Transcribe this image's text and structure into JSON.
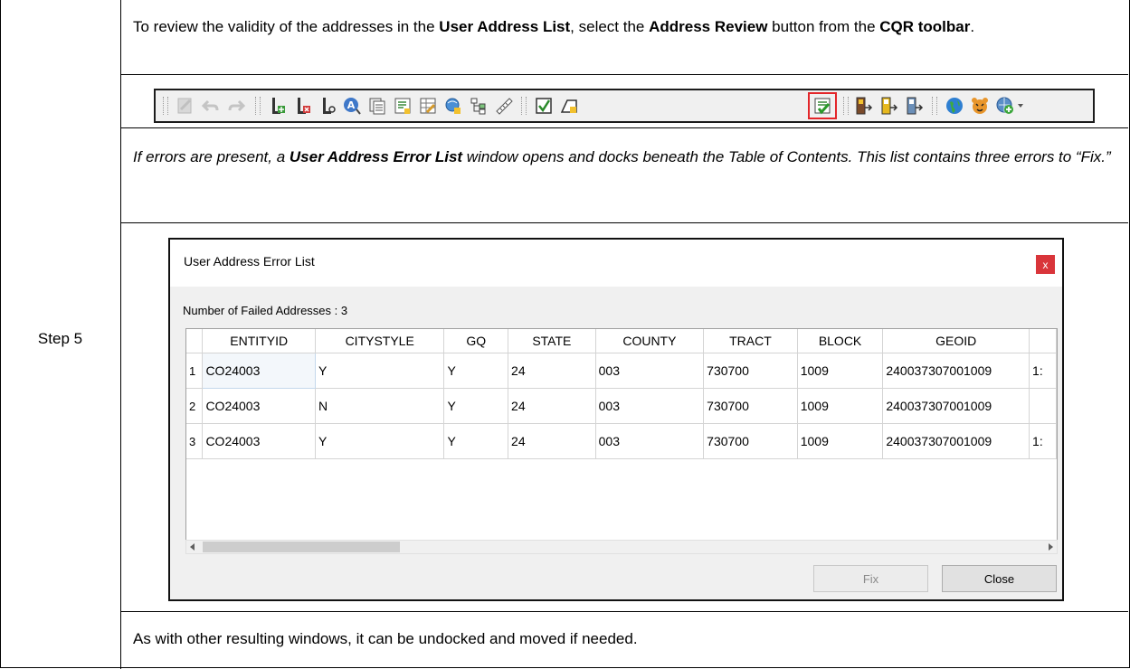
{
  "step_label": "Step 5",
  "intro": {
    "p1": "To review the validity of the addresses in the ",
    "b1": "User Address List",
    "p2": ", select the ",
    "b2": "Address Review",
    "p3": " button from the ",
    "b3": "CQR toolbar",
    "p4": "."
  },
  "toolbar": {
    "icons": [
      "edit-disabled-icon",
      "undo-icon",
      "redo-icon",
      "add-address-icon",
      "delete-address-icon",
      "move-address-icon",
      "address-query-icon",
      "list-icon",
      "list-star-icon",
      "table-edit-icon",
      "geocode-icon",
      "tree-icon",
      "measure-icon",
      "check-icon",
      "polygon-edit-icon",
      "address-review-icon",
      "export-1-icon",
      "export-2-icon",
      "export-3-icon",
      "globe-icon",
      "tiger-icon",
      "add-layer-icon"
    ],
    "highlighted": "address-review-icon",
    "highlight_color": "#e3262a"
  },
  "note": {
    "p1": "If errors are present, a ",
    "b1": "User Address Error List",
    "p2": " window opens and docks beneath the Table of Contents",
    "p3": ". This list contains three errors to “Fix",
    "p4": ".”"
  },
  "dialog": {
    "title": "User Address Error List",
    "close_glyph": "x",
    "failed_label": "Number of Failed Addresses : 3",
    "columns": [
      "ENTITYID",
      "CITYSTYLE",
      "GQ",
      "STATE",
      "COUNTY",
      "TRACT",
      "BLOCK",
      "GEOID"
    ],
    "rows": [
      {
        "n": "1",
        "entityid": "CO24003",
        "citystyle": "Y",
        "gq": "Y",
        "state": "24",
        "county": "003",
        "tract": "730700",
        "block": "1009",
        "geoid": "240037307001009",
        "extra": "1:"
      },
      {
        "n": "2",
        "entityid": "CO24003",
        "citystyle": "N",
        "gq": "Y",
        "state": "24",
        "county": "003",
        "tract": "730700",
        "block": "1009",
        "geoid": "240037307001009",
        "extra": ""
      },
      {
        "n": "3",
        "entityid": "CO24003",
        "citystyle": "Y",
        "gq": "Y",
        "state": "24",
        "county": "003",
        "tract": "730700",
        "block": "1009",
        "geoid": "240037307001009",
        "extra": "1:"
      }
    ],
    "fix_label": "Fix",
    "close_label": "Close"
  },
  "footer": "As with other resulting windows, it can be undocked and moved if needed."
}
